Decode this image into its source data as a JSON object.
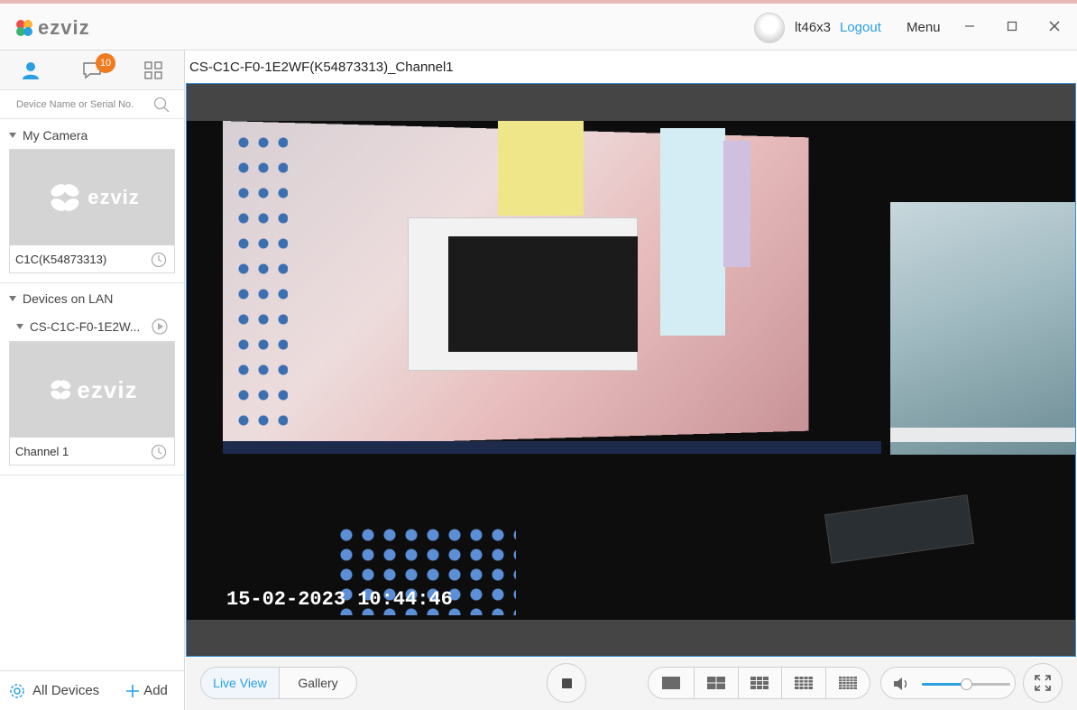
{
  "app": {
    "logo_text": "ezviz",
    "username": "lt46x3",
    "logout_label": "Logout",
    "menu_label": "Menu",
    "brand_color": "#2aa0e0",
    "badge_color": "#f07a1e"
  },
  "sidebar": {
    "tabs": [
      {
        "icon": "user-icon"
      },
      {
        "icon": "message-icon",
        "badge": "10"
      },
      {
        "icon": "grid-icon"
      }
    ],
    "search_placeholder": "Device Name or Serial No.",
    "my_camera": {
      "heading": "My Camera",
      "thumb_logo": "ezviz",
      "camera_label": "C1C(K54873313)"
    },
    "lan": {
      "heading": "Devices on LAN",
      "device_name": "CS-C1C-F0-1E2W...",
      "thumb_logo": "ezviz",
      "channel_label": "Channel 1"
    },
    "footer": {
      "all_devices_label": "All Devices",
      "add_label": "Add"
    }
  },
  "main": {
    "channel_title": "CS-C1C-F0-1E2WF(K54873313)_Channel1",
    "video_timestamp": "15-02-2023 10:44:46"
  },
  "controls": {
    "view_modes": {
      "live_view": "Live View",
      "gallery": "Gallery",
      "active": "Live View"
    },
    "layouts": [
      "1x1",
      "2x2",
      "3x3",
      "4x4",
      "5x5"
    ],
    "volume_level": 0.5
  }
}
